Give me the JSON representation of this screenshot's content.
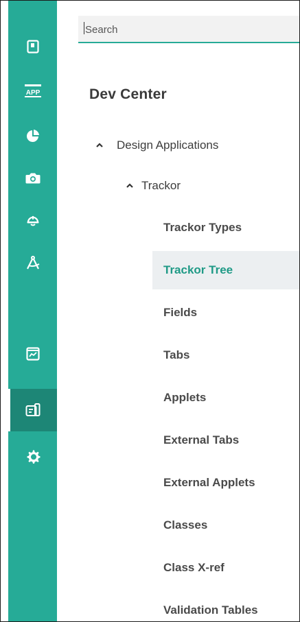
{
  "search": {
    "placeholder": "Search"
  },
  "page": {
    "title": "Dev Center"
  },
  "tree": {
    "root": {
      "label": "Design Applications",
      "expanded": true
    },
    "child": {
      "label": "Trackor",
      "expanded": true
    },
    "items": [
      {
        "label": "Trackor Types"
      },
      {
        "label": "Trackor Tree",
        "selected": true
      },
      {
        "label": "Fields"
      },
      {
        "label": "Tabs"
      },
      {
        "label": "Applets"
      },
      {
        "label": "External Tabs"
      },
      {
        "label": "External Applets"
      },
      {
        "label": "Classes"
      },
      {
        "label": "Class X-ref"
      },
      {
        "label": "Validation Tables"
      }
    ]
  },
  "rail": {
    "items": [
      {
        "icon": "book-icon"
      },
      {
        "icon": "app-icon",
        "text": "APP"
      },
      {
        "icon": "pie-chart-icon"
      },
      {
        "icon": "camera-icon"
      },
      {
        "icon": "hard-hat-icon"
      },
      {
        "icon": "compass-icon"
      },
      {
        "icon": "analytics-icon"
      },
      {
        "icon": "dev-center-icon",
        "active": true
      },
      {
        "icon": "gear-icon"
      }
    ]
  },
  "colors": {
    "rail": "#26ab97",
    "rail_active": "#1d8676",
    "accent_text": "#1f9a86",
    "selected_bg": "#eceff1"
  }
}
